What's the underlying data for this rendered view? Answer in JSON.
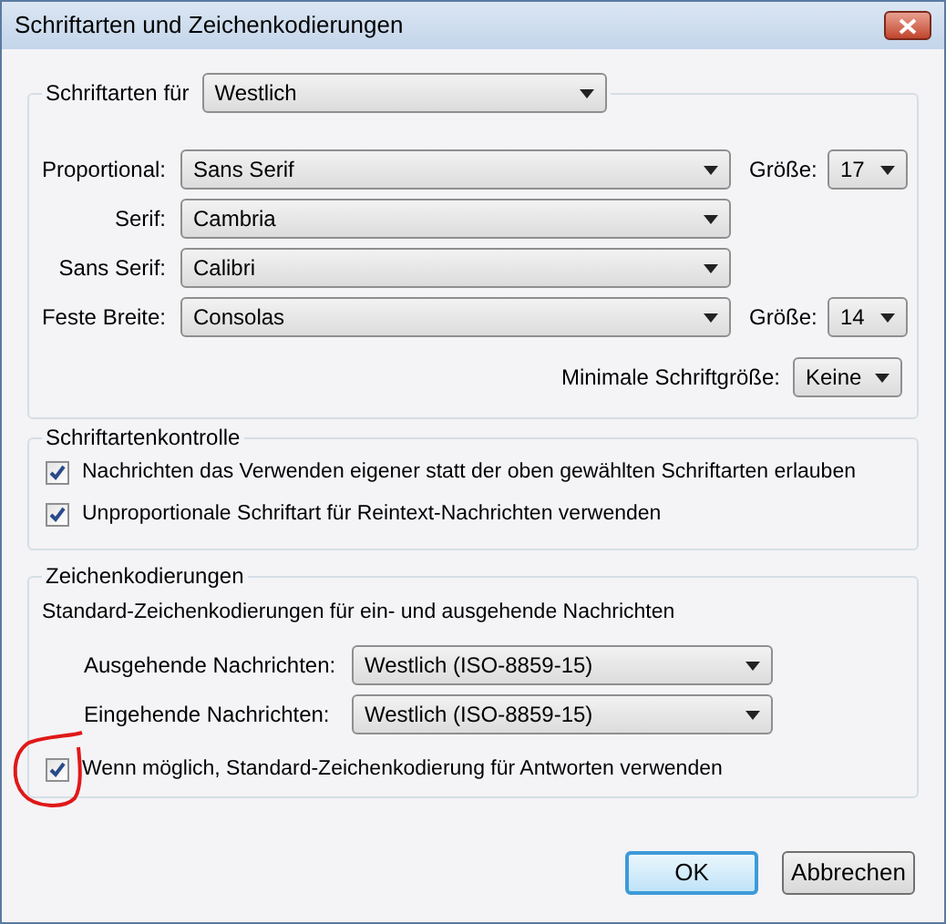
{
  "window": {
    "title": "Schriftarten und Zeichenkodierungen"
  },
  "fonts": {
    "legend_label": "Schriftarten für",
    "legend_value": "Westlich",
    "rows": [
      {
        "label": "Proportional:",
        "value": "Sans Serif",
        "size_label": "Größe:",
        "size_value": "17"
      },
      {
        "label": "Serif:",
        "value": "Cambria"
      },
      {
        "label": "Sans Serif:",
        "value": "Calibri"
      },
      {
        "label": "Feste Breite:",
        "value": "Consolas",
        "size_label": "Größe:",
        "size_value": "14"
      }
    ],
    "minimum": {
      "label": "Minimale Schriftgröße:",
      "value": "Keine"
    }
  },
  "font_control": {
    "title": "Schriftartenkontrolle",
    "options": [
      {
        "label": "Nachrichten das Verwenden eigener statt der oben gewählten Schriftarten erlauben",
        "checked": true
      },
      {
        "label": "Unproportionale Schriftart für Reintext-Nachrichten verwenden",
        "checked": true
      }
    ]
  },
  "encodings": {
    "title": "Zeichenkodierungen",
    "description": "Standard-Zeichenkodierungen für ein- und ausgehende Nachrichten",
    "fields": [
      {
        "label": "Ausgehende Nachrichten:",
        "value": "Westlich (ISO-8859-15)"
      },
      {
        "label": "Eingehende Nachrichten:",
        "value": "Westlich (ISO-8859-15)"
      }
    ],
    "options": [
      {
        "label": "Wenn möglich, Standard-Zeichenkodierung für Antworten verwenden",
        "checked": true
      }
    ]
  },
  "buttons": [
    {
      "label": "OK",
      "default": true
    },
    {
      "label": "Abbrechen",
      "default": false
    }
  ]
}
